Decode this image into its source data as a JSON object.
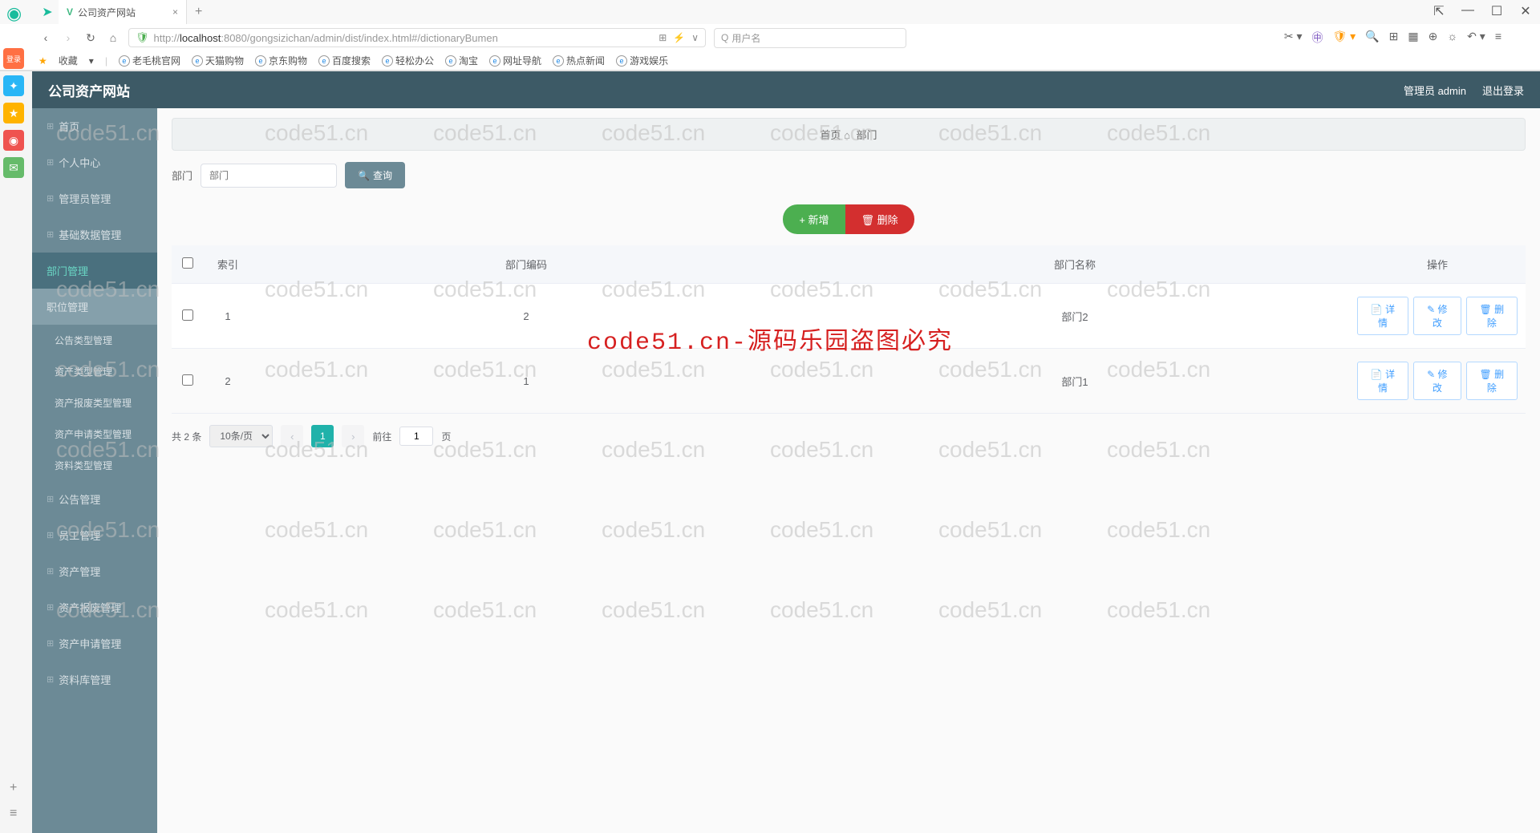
{
  "browser": {
    "tab_title": "公司资产网站",
    "url_protocol": "http://",
    "url_host": "localhost",
    "url_port": ":8080",
    "url_path": "/gongsizichan/admin/dist/index.html#/dictionaryBumen",
    "search_placeholder": "用户名",
    "bookmarks": [
      "老毛桃官网",
      "天猫购物",
      "京东购物",
      "百度搜索",
      "轻松办公",
      "淘宝",
      "网址导航",
      "热点新闻",
      "游戏娱乐"
    ],
    "bookmark_label": "收藏"
  },
  "header": {
    "title": "公司资产网站",
    "user": "管理员 admin",
    "logout": "退出登录"
  },
  "sidebar": {
    "items": [
      {
        "label": "首页"
      },
      {
        "label": "个人中心"
      },
      {
        "label": "管理员管理"
      },
      {
        "label": "基础数据管理"
      },
      {
        "label": "部门管理",
        "active": true
      },
      {
        "label": "职位管理",
        "hover": true
      },
      {
        "label": "公告类型管理",
        "sub": true
      },
      {
        "label": "资产类型管理",
        "sub": true
      },
      {
        "label": "资产报废类型管理",
        "sub": true
      },
      {
        "label": "资产申请类型管理",
        "sub": true
      },
      {
        "label": "资料类型管理",
        "sub": true
      },
      {
        "label": "公告管理"
      },
      {
        "label": "员工管理"
      },
      {
        "label": "资产管理"
      },
      {
        "label": "资产报废管理"
      },
      {
        "label": "资产申请管理"
      },
      {
        "label": "资料库管理"
      }
    ]
  },
  "breadcrumb": {
    "home": "首页",
    "current": "部门"
  },
  "search": {
    "label": "部门",
    "placeholder": "部门",
    "button": "查询"
  },
  "actions": {
    "add": "新增",
    "delete": "删除"
  },
  "table": {
    "headers": [
      "索引",
      "部门编码",
      "部门名称",
      "操作"
    ],
    "rows": [
      {
        "index": "1",
        "code": "2",
        "name": "部门2"
      },
      {
        "index": "2",
        "code": "1",
        "name": "部门1"
      }
    ],
    "row_actions": {
      "detail": "详情",
      "edit": "修改",
      "delete": "删除"
    }
  },
  "pagination": {
    "total": "共 2 条",
    "page_size": "10条/页",
    "current": "1",
    "goto_prefix": "前往",
    "goto_value": "1",
    "goto_suffix": "页"
  },
  "watermark_text": "code51.cn",
  "watermark_big": "code51.cn-源码乐园盗图必究"
}
